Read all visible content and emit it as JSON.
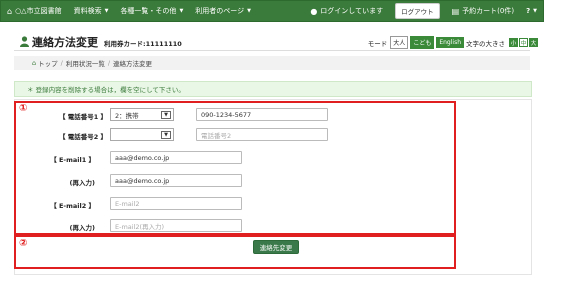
{
  "nav": {
    "home": "○△市立図書館",
    "items": [
      "資料検索",
      "各種一覧・その他",
      "利用者のページ"
    ],
    "login_status": "ログインしています",
    "logout": "ログアウト",
    "reserve_cart": "予約カート(0件)",
    "help": "?"
  },
  "header": {
    "title": "連絡方法変更",
    "card_label": "利用券カード:11111110"
  },
  "mode": {
    "label": "モード",
    "adult": "大人",
    "child": "こども",
    "english": "English",
    "text_size_label": "文字の大きさ",
    "small": "小",
    "medium": "中",
    "large": "大"
  },
  "breadcrumb": [
    "トップ",
    "利用状況一覧",
    "連絡方法変更"
  ],
  "notice": "＊ 登録内容を削除する場合は，欄を空にして下さい。",
  "annotations": [
    "①",
    "②"
  ],
  "form": {
    "phone1_label": "【 電話番号1 】",
    "phone1_type": "2：携帯",
    "phone1_value": "090-1234-5677",
    "phone2_label": "【 電話番号2 】",
    "phone2_type": "",
    "phone2_placeholder": "電話番号2",
    "email1_label": "【 E-mail1 】",
    "email1_value": "aaa@demo.co.jp",
    "reenter_label": "(再入力)",
    "email1_confirm": "aaa@demo.co.jp",
    "email2_label": "【 E-mail2 】",
    "email2_placeholder": "E-mail2",
    "email2_confirm_placeholder": "E-mail2(再入力)",
    "submit": "連絡先変更"
  }
}
